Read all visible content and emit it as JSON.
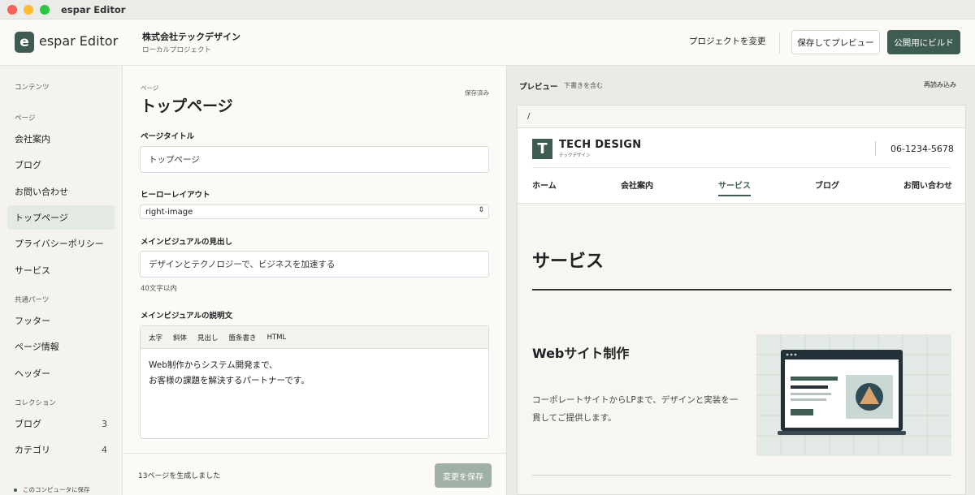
{
  "window": {
    "title": "espar Editor"
  },
  "header": {
    "logo_letter": "e",
    "app_name": "espar Editor",
    "company": "株式会社テックデザイン",
    "project_type": "ローカルプロジェクト",
    "change_project": "プロジェクトを変更",
    "save_preview": "保存してプレビュー",
    "build": "公開用にビルド"
  },
  "sidebar": {
    "contents_label": "コンテンツ",
    "pages_label": "ページ",
    "pages": [
      "会社案内",
      "ブログ",
      "お問い合わせ",
      "トップページ",
      "プライバシーポリシー",
      "サービス"
    ],
    "active_page": "トップページ",
    "shared_label": "共通パーツ",
    "shared": [
      "フッター",
      "ページ情報",
      "ヘッダー"
    ],
    "collections_label": "コレクション",
    "collections": [
      {
        "label": "ブログ",
        "count": "3"
      },
      {
        "label": "カテゴリ",
        "count": "4"
      }
    ],
    "local_save": "このコンピュータに保存"
  },
  "editor": {
    "kind_label": "ページ",
    "title": "トップページ",
    "saved_status": "保存済み",
    "fields": {
      "page_title_label": "ページタイトル",
      "page_title_value": "トップページ",
      "hero_layout_label": "ヒーローレイアウト",
      "hero_layout_value": "right-image",
      "main_visual_heading_label": "メインビジュアルの見出し",
      "main_visual_heading_value": "デザインとテクノロジーで、ビジネスを加速する",
      "main_visual_heading_hint": "40文字以内",
      "main_visual_desc_label": "メインビジュアルの説明文",
      "toolbar": [
        "太字",
        "斜体",
        "見出し",
        "箇条書き",
        "HTML"
      ],
      "desc_line1": "Web制作からシステム開発まで、",
      "desc_line2": "お客様の課題を解決するパートナーです。"
    },
    "footer": {
      "status": "13ページを生成しました",
      "save_button": "変更を保存"
    }
  },
  "preview": {
    "title": "プレビュー",
    "subtitle": "下書きを含む",
    "reload": "再読み込み",
    "url": "/",
    "site": {
      "logo_letter": "T",
      "name": "TECH DESIGN",
      "kana": "テックデザイン",
      "phone": "06-1234-5678",
      "nav": [
        "ホーム",
        "会社案内",
        "サービス",
        "ブログ",
        "お問い合わせ"
      ],
      "active_nav": "サービス",
      "heading": "サービス",
      "service_title": "Webサイト制作",
      "service_desc": "コーポレートサイトからLPまで、デザインと実装を一貫してご提供します。"
    }
  },
  "colors": {
    "accent": "#3f5c52",
    "accent_muted": "#9fb0a6",
    "sidebar_bg": "#f4f3ee",
    "active_item_bg": "#e5e9e3"
  }
}
